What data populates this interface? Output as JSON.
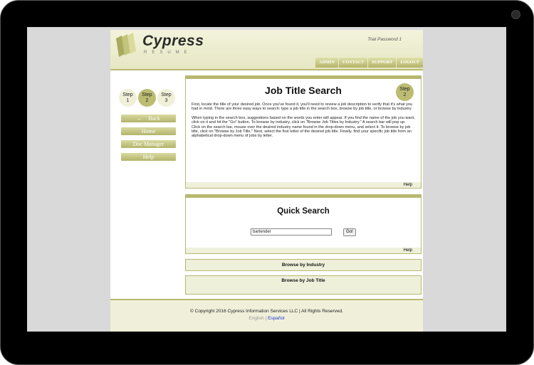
{
  "header": {
    "brand": "Cypress",
    "brand_sub": "RESUME",
    "trial_text": "Trial Password 1",
    "nav": [
      "ADMIN",
      "CONTACT",
      "SUPPORT",
      "LOGOUT"
    ]
  },
  "sidebar": {
    "steps": [
      {
        "label": "Step",
        "num": "1"
      },
      {
        "label": "Step",
        "num": "2"
      },
      {
        "label": "Step",
        "num": "3"
      }
    ],
    "back_arrow": "←",
    "back": "Back",
    "home": "Home",
    "doc_manager": "Doc Manager",
    "help": "Help"
  },
  "job_title_search": {
    "title": "Job Title Search",
    "badge_label": "Step",
    "badge_num": "2",
    "para1": "First, locate the title of your desired job. Once you've found it, you'll need to review a job description to verify that it's what you had in mind. There are three easy ways to search: type a job title in the search box, browse by job title, or browse by industry.",
    "para2": "When typing in the search box, suggestions based on the words you enter will appear. If you find the name of the job you want, click on it and hit the \"Go\" button. To browse by industry, click on \"Browse Job Titles by Industry.\" A search bar will pop up. Click on the search bar, mouse over the desired industry name found in the drop-down menu, and select it. To browse by job title, click on \"Browse by Job Title.\" Next, select the first letter of the desired job title. Finally, find your specific job title from an alphabetical drop-down menu of jobs by letter.",
    "help": "Help"
  },
  "quick_search": {
    "title": "Quick Search",
    "input_value": "bartender",
    "go": "Go!",
    "help": "Help"
  },
  "browse": {
    "industry": "Browse by Industry",
    "job_title": "Browse by Job Title"
  },
  "footer": {
    "copyright": "© Copyright 2016 Cypress Information Services LLC | All Rights Reserved.",
    "lang_en": "English",
    "lang_sep": "|",
    "lang_es": "Español"
  },
  "colors": {
    "accent": "#b7b870",
    "accent_light": "#eff0da",
    "link": "#2233cc"
  }
}
